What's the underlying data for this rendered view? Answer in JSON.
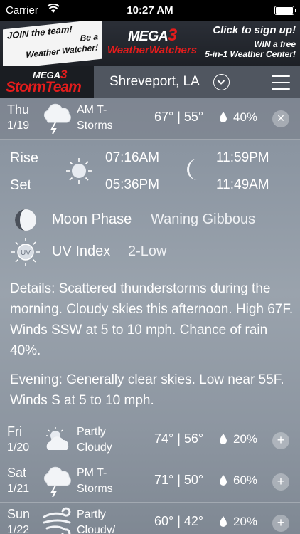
{
  "status_bar": {
    "carrier": "Carrier",
    "time": "10:27 AM"
  },
  "banner": {
    "join_line1": "JOIN the team!",
    "join_line2": "Be a",
    "join_line3": "Weather Watcher!",
    "mega_text": "MEGA",
    "mega_number": "3",
    "watchers_text": "WeatherWatchers",
    "click_text": "Click to sign up!",
    "win_line1": "WIN a free",
    "win_line2": "5-in-1 Weather Center!"
  },
  "header": {
    "logo_mega": "MEGA",
    "logo_number": "3",
    "logo_name": "StormTeam",
    "city": "Shreveport, LA"
  },
  "days": [
    {
      "name": "Thu",
      "date": "1/19",
      "condition": "AM T-Storms",
      "temps": "67° | 55°",
      "precip": "40%",
      "icon": "thunderstorm-icon",
      "action": "×"
    },
    {
      "name": "Fri",
      "date": "1/20",
      "condition": "Partly Cloudy",
      "temps": "74° | 56°",
      "precip": "20%",
      "icon": "partly-cloudy-icon",
      "action": "+"
    },
    {
      "name": "Sat",
      "date": "1/21",
      "condition": "PM T-Storms",
      "temps": "71° | 50°",
      "precip": "60%",
      "icon": "thunderstorm-icon",
      "action": "+"
    },
    {
      "name": "Sun",
      "date": "1/22",
      "condition": "Partly Cloudy/",
      "temps": "60° | 42°",
      "precip": "20%",
      "icon": "windy-icon",
      "action": "+"
    }
  ],
  "detail": {
    "rise_label": "Rise",
    "set_label": "Set",
    "sunrise": "07:16AM",
    "sunset": "05:36PM",
    "moonrise": "11:59PM",
    "moonset": "11:49AM",
    "moon_phase_label": "Moon Phase",
    "moon_phase_value": "Waning Gibbous",
    "uv_label": "UV Index",
    "uv_value": "2-Low",
    "uv_icon_text": "UV",
    "details_text": "Details: Scattered thunderstorms during the morning. Cloudy skies this afternoon. High 67F. Winds SSW at 5 to 10 mph. Chance of rain 40%.",
    "evening_text": "Evening: Generally clear skies. Low near 55F. Winds S at 5 to 10 mph."
  }
}
